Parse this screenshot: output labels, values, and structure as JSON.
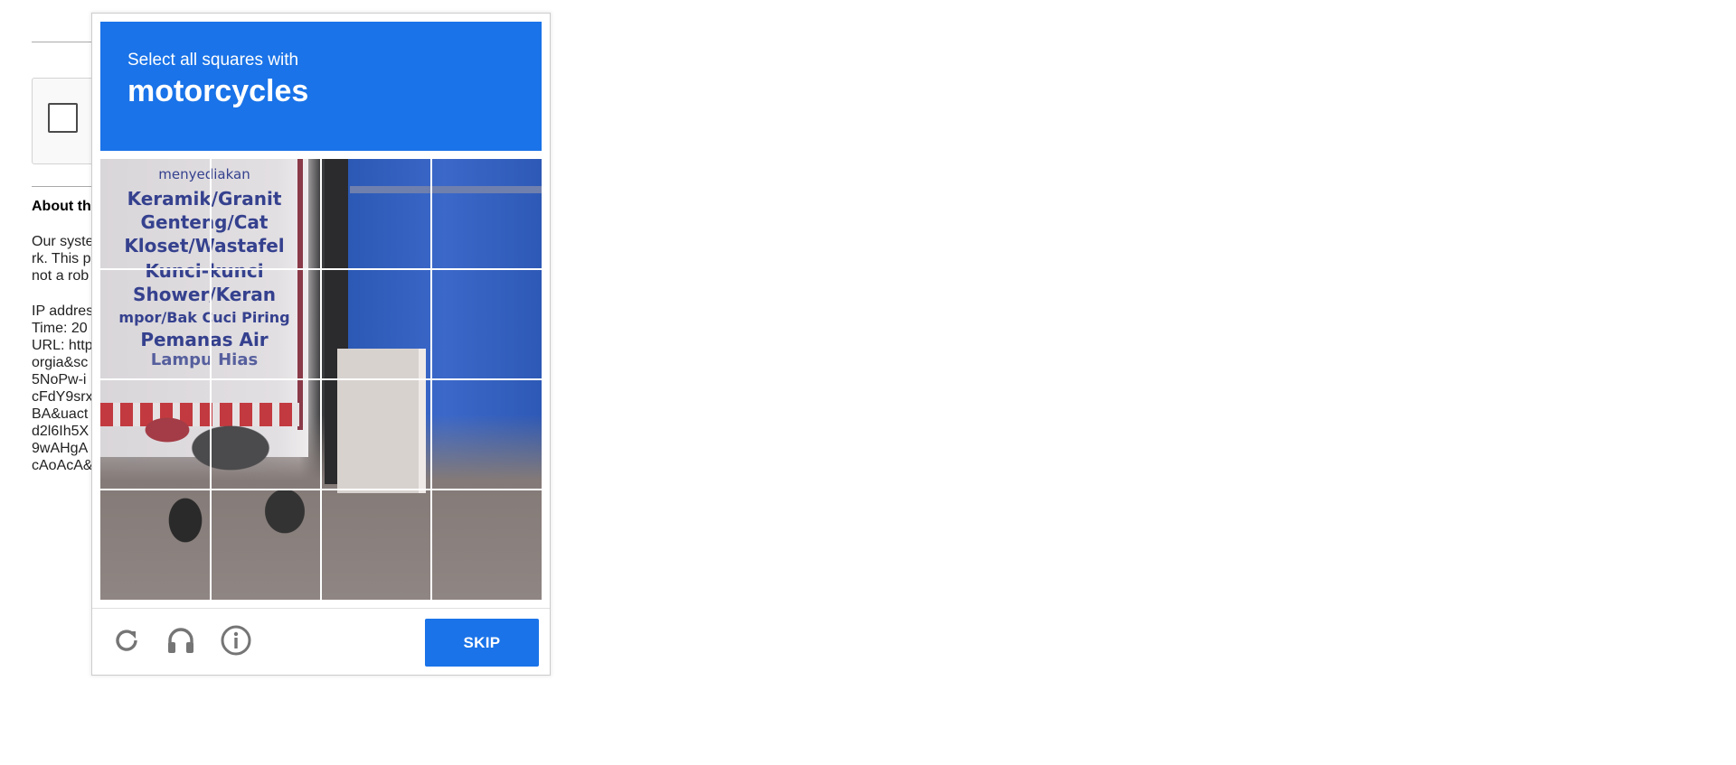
{
  "background_page": {
    "heading_partial": "About th",
    "paragraph1_partial": [
      "Our syste",
      "rk. This p",
      "not a rob"
    ],
    "paragraph2_partial": [
      "IP addres",
      "Time: 20",
      "URL: http",
      "orgia&sc",
      "5NoPw-i",
      "cFdY9srx",
      "BA&uact",
      "d2l6Ih5X",
      "9wAHgA",
      "cAoAcA&"
    ]
  },
  "captcha": {
    "instruction": "Select all squares with",
    "target": "motorcycles",
    "sign_text": [
      "menyediakan",
      "Keramik/Granit",
      "Genteng/Cat",
      "Kloset/Wastafel",
      "Kunci-kunci",
      "Shower/Keran",
      "mpor/Bak Cuci Piring",
      "Pemanas Air",
      "Lampu Hias"
    ],
    "grid": {
      "rows": 4,
      "cols": 4,
      "selected_tiles": 0
    },
    "footer": {
      "reload_icon": "reload-icon",
      "audio_icon": "headphones-icon",
      "info_icon": "info-icon",
      "skip_label": "SKIP"
    },
    "colors": {
      "accent": "#1a73e8",
      "icon_gray": "#757575"
    }
  }
}
